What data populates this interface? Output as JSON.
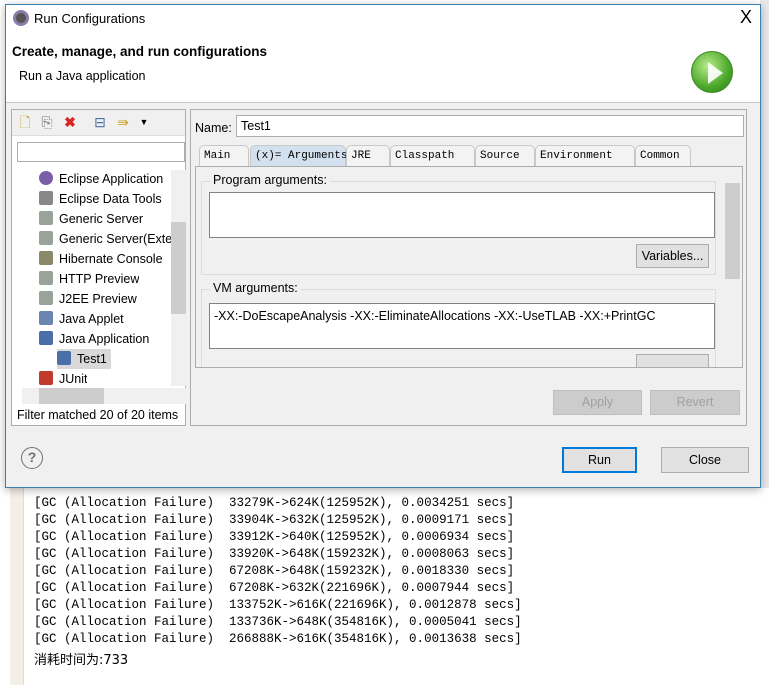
{
  "console": {
    "lines": [
      "[GC (Allocation Failure)  33279K->624K(125952K), 0.0034251 secs]",
      "[GC (Allocation Failure)  33904K->632K(125952K), 0.0009171 secs]",
      "[GC (Allocation Failure)  33912K->640K(125952K), 0.0006934 secs]",
      "[GC (Allocation Failure)  33920K->648K(159232K), 0.0008063 secs]",
      "[GC (Allocation Failure)  67208K->648K(159232K), 0.0018330 secs]",
      "[GC (Allocation Failure)  67208K->632K(221696K), 0.0007944 secs]",
      "[GC (Allocation Failure)  133752K->616K(221696K), 0.0012878 secs]",
      "[GC (Allocation Failure)  133736K->648K(354816K), 0.0005041 secs]",
      "[GC (Allocation Failure)  266888K->616K(354816K), 0.0013638 secs]"
    ],
    "result": "消耗时间为:733"
  },
  "dialog": {
    "title": "Run Configurations",
    "close": "X",
    "header_title": "Create, manage, and run configurations",
    "header_subtitle": "Run a Java application",
    "tree": [
      {
        "label": "Eclipse Application",
        "color": "#7a5ea8"
      },
      {
        "label": "Eclipse Data Tools",
        "color": "#888888"
      },
      {
        "label": "Generic Server",
        "color": "#9aa39a"
      },
      {
        "label": "Generic Server(External)",
        "color": "#9aa39a"
      },
      {
        "label": "Hibernate Console",
        "color": "#8a8a6a"
      },
      {
        "label": "HTTP Preview",
        "color": "#9aa39a"
      },
      {
        "label": "J2EE Preview",
        "color": "#9aa39a"
      },
      {
        "label": "Java Applet",
        "color": "#6a86b0"
      },
      {
        "label": "Java Application",
        "color": "#4a6fa8"
      },
      {
        "label": "Test1",
        "color": "#4a6fa8"
      },
      {
        "label": "JUnit",
        "color": "#c0392b"
      }
    ],
    "filter_status": "Filter matched 20 of 20 items",
    "name_label": "Name:",
    "name_value": "Test1",
    "tabs": [
      "Main",
      "(x)= Arguments",
      "JRE",
      "Classpath",
      "Source",
      "Environment",
      "Common"
    ],
    "active_tab": "(x)= Arguments",
    "program_args_label": "Program arguments:",
    "program_args": "",
    "variables_button": "Variables...",
    "vm_args_label": "VM arguments:",
    "vm_args": "-XX:-DoEscapeAnalysis -XX:-EliminateAllocations  -XX:-UseTLAB -XX:+PrintGC",
    "apply": "Apply",
    "revert": "Revert",
    "run": "Run",
    "close_button": "Close",
    "help": "?"
  }
}
